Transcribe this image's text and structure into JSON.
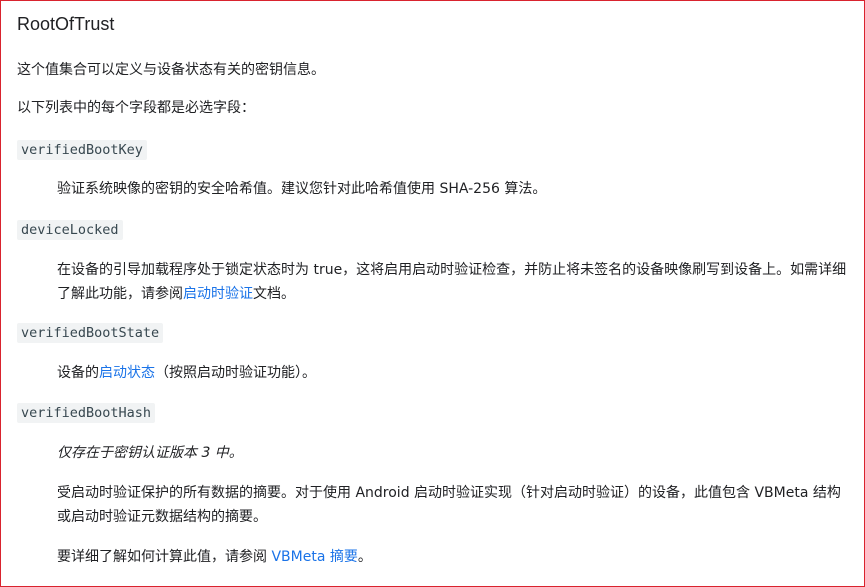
{
  "title": "RootOfTrust",
  "intro": "这个值集合可以定义与设备状态有关的密钥信息。",
  "required_note": "以下列表中的每个字段都是必选字段：",
  "fields": [
    {
      "name": "verifiedBootKey",
      "desc": "验证系统映像的密钥的安全哈希值。建议您针对此哈希值使用 SHA-256 算法。"
    },
    {
      "name": "deviceLocked",
      "desc_pre": "在设备的引导加载程序处于锁定状态时为 true，这将启用启动时验证检查，并防止将未签名的设备映像刷写到设备上。如需详细了解此功能，请参阅",
      "desc_link": "启动时验证",
      "desc_post": "文档。"
    },
    {
      "name": "verifiedBootState",
      "desc_pre": "设备的",
      "desc_link": "启动状态",
      "desc_post": "（按照启动时验证功能）。"
    },
    {
      "name": "verifiedBootHash",
      "note": "仅存在于密钥认证版本 3 中。",
      "desc": "受启动时验证保护的所有数据的摘要。对于使用 Android 启动时验证实现（针对启动时验证）的设备，此值包含 VBMeta 结构或启动时验证元数据结构的摘要。",
      "more_pre": "要详细了解如何计算此值，请参阅 ",
      "more_link": "VBMeta 摘要",
      "more_post": "。"
    }
  ]
}
